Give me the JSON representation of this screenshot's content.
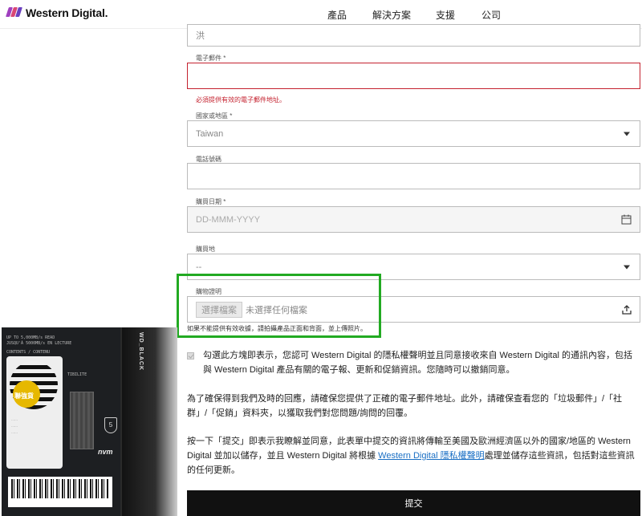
{
  "header": {
    "brand": "Western Digital.",
    "nav": [
      "產品",
      "解決方案",
      "支援",
      "公司"
    ],
    "accent_colors": [
      "#a03fbf",
      "#d94675",
      "#6a3fbf"
    ]
  },
  "form": {
    "last_name_value": "洪",
    "email": {
      "label": "電子郵件 *",
      "value": "",
      "error": "必須提供有效的電子郵件地址。"
    },
    "country": {
      "label": "國家或地區 *",
      "value": "Taiwan"
    },
    "phone": {
      "label": "電話號碼",
      "value": ""
    },
    "purchase_date": {
      "label": "購買日期 *",
      "placeholder": "DD-MMM-YYYY"
    },
    "purchase_place": {
      "label": "購買地",
      "value": "--"
    },
    "proof": {
      "label": "購物證明",
      "button": "選擇檔案",
      "status": "未選擇任何檔案"
    },
    "proof_note": "如果不能提供有效收據，請拍攝產品正面和背面，並上傳照片。",
    "consent_text": "勾選此方塊即表示，您認可 Western Digital 的隱私權聲明並且同意接收來自 Western Digital 的通訊內容，包括與 Western Digital 產品有關的電子報、更新和促銷資訊。您隨時可以撤銷同意。",
    "info_text": "為了確保得到我們及時的回應，請確保您提供了正確的電子郵件地址。此外，請確保查看您的「垃圾郵件」/「社群」/「促銷」資料夾，以獲取我們對您問題/詢問的回覆。",
    "submit_note_prefix": "按一下「提交」即表示我瞭解並同意，此表單中提交的資訊將傳輸至美國及歐洲經濟區以外的國家/地區的 Western Digital 並加以儲存，並且 Western Digital 將根據 ",
    "submit_note_link": "Western Digital 隱私權聲明",
    "submit_note_suffix": "處理並儲存這些資訊，包括對這些資訊的任何更新。",
    "submit_label": "提交",
    "error_color": "#c4222f",
    "highlight_color": "#22aa22"
  },
  "photo": {
    "lines": [
      "UP TO 5,000MB/s READ",
      "JUSQU'À 5000MB/s EN LECTURE",
      "CONTENTS / CONTENU",
      "TIBILITE"
    ],
    "vertical_label": "WD_BLACK",
    "sticker_label": "聯強貨",
    "brand": "Western Digital",
    "nvm": "nvm",
    "badge": "5"
  }
}
